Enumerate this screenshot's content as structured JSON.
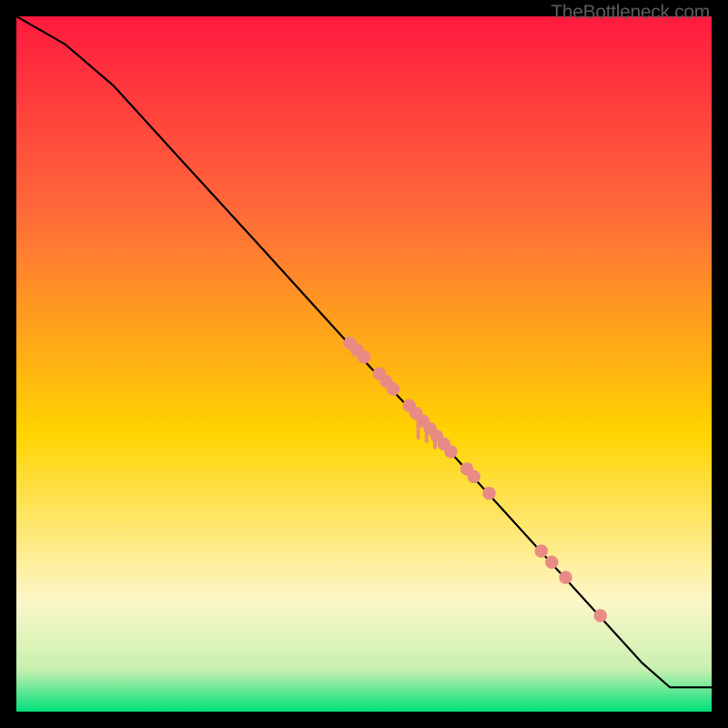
{
  "watermark": "TheBottleneck.com",
  "colors": {
    "bg": "#000000",
    "grad_top": "#ff1a3f",
    "grad_upper": "#ff6a3a",
    "grad_mid": "#ffd400",
    "grad_lower_cream": "#fdf6c8",
    "grad_green": "#00e07a",
    "curve": "#000000",
    "point": "#e98b85",
    "point_drip": "#e98b85"
  },
  "chart_data": {
    "type": "line",
    "title": "",
    "xlabel": "",
    "ylabel": "",
    "xlim": [
      0,
      100
    ],
    "ylim": [
      0,
      100
    ],
    "curve": [
      {
        "x": 0,
        "y": 100
      },
      {
        "x": 7,
        "y": 96
      },
      {
        "x": 14,
        "y": 90
      },
      {
        "x": 24,
        "y": 79
      },
      {
        "x": 35,
        "y": 67
      },
      {
        "x": 45,
        "y": 56
      },
      {
        "x": 50,
        "y": 50.5
      },
      {
        "x": 60,
        "y": 40
      },
      {
        "x": 70,
        "y": 29
      },
      {
        "x": 80,
        "y": 18
      },
      {
        "x": 90,
        "y": 7
      },
      {
        "x": 94,
        "y": 3.5
      },
      {
        "x": 100,
        "y": 3.5
      }
    ],
    "points": [
      {
        "x": 48.0,
        "y": 53.0
      },
      {
        "x": 49.0,
        "y": 52.0
      },
      {
        "x": 50.0,
        "y": 51.0
      },
      {
        "x": 52.2,
        "y": 48.6
      },
      {
        "x": 53.2,
        "y": 47.5
      },
      {
        "x": 54.2,
        "y": 46.4
      },
      {
        "x": 56.5,
        "y": 44.0
      },
      {
        "x": 57.5,
        "y": 42.9
      },
      {
        "x": 58.5,
        "y": 41.8
      },
      {
        "x": 59.5,
        "y": 40.7
      },
      {
        "x": 60.5,
        "y": 39.6
      },
      {
        "x": 61.5,
        "y": 38.5
      },
      {
        "x": 62.5,
        "y": 37.4
      },
      {
        "x": 64.8,
        "y": 34.9
      },
      {
        "x": 65.8,
        "y": 33.8
      },
      {
        "x": 68.0,
        "y": 31.4
      },
      {
        "x": 75.5,
        "y": 23.1
      },
      {
        "x": 77.0,
        "y": 21.5
      },
      {
        "x": 79.0,
        "y": 19.3
      },
      {
        "x": 84.0,
        "y": 13.8
      }
    ],
    "drips": [
      {
        "x": 57.8,
        "y_top": 42.6,
        "len": 3.2
      },
      {
        "x": 59.0,
        "y_top": 41.3,
        "len": 2.4
      },
      {
        "x": 60.2,
        "y_top": 40.0,
        "len": 2.0
      }
    ]
  }
}
